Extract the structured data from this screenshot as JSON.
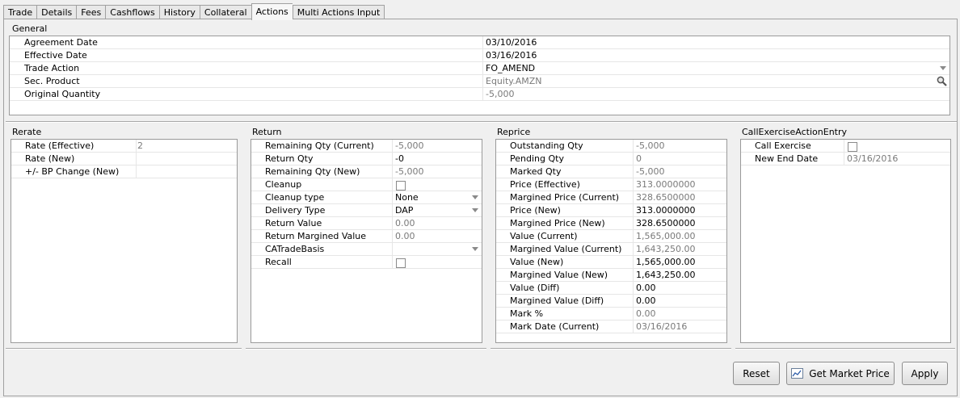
{
  "tabs": [
    {
      "label": "Trade",
      "active": false
    },
    {
      "label": "Details",
      "active": false
    },
    {
      "label": "Fees",
      "active": false
    },
    {
      "label": "Cashflows",
      "active": false
    },
    {
      "label": "History",
      "active": false
    },
    {
      "label": "Collateral",
      "active": false
    },
    {
      "label": "Actions",
      "active": true
    },
    {
      "label": "Multi Actions Input",
      "active": false
    }
  ],
  "general": {
    "title": "General",
    "rows": [
      {
        "label": "Agreement Date",
        "value": "03/10/2016"
      },
      {
        "label": "Effective Date",
        "value": "03/16/2016"
      },
      {
        "label": "Trade Action",
        "value": "FO_AMEND"
      },
      {
        "label": "Sec. Product",
        "value": "Equity.AMZN"
      },
      {
        "label": "Original Quantity",
        "value": "-5,000"
      }
    ]
  },
  "rerate": {
    "title": "Rerate",
    "rows": [
      {
        "label": "Rate (Effective)",
        "value": "2"
      },
      {
        "label": "Rate (New)",
        "value": ""
      },
      {
        "label": "+/- BP Change (New)",
        "value": ""
      }
    ]
  },
  "return": {
    "title": "Return",
    "rows": [
      {
        "label": "Remaining Qty (Current)",
        "value": "-5,000"
      },
      {
        "label": "Return Qty",
        "value": "-0"
      },
      {
        "label": "Remaining Qty (New)",
        "value": "-5,000"
      },
      {
        "label": "Cleanup",
        "value": ""
      },
      {
        "label": "Cleanup type",
        "value": "None"
      },
      {
        "label": "Delivery Type",
        "value": "DAP"
      },
      {
        "label": "Return Value",
        "value": "0.00"
      },
      {
        "label": "Return Margined Value",
        "value": "0.00"
      },
      {
        "label": "CATradeBasis",
        "value": ""
      },
      {
        "label": "Recall",
        "value": ""
      }
    ]
  },
  "reprice": {
    "title": "Reprice",
    "rows": [
      {
        "label": "Outstanding Qty",
        "value": "-5,000"
      },
      {
        "label": "Pending Qty",
        "value": "0"
      },
      {
        "label": "Marked Qty",
        "value": "-5,000"
      },
      {
        "label": "Price (Effective)",
        "value": "313.0000000"
      },
      {
        "label": "Margined Price (Current)",
        "value": "328.6500000"
      },
      {
        "label": "Price (New)",
        "value": "313.0000000"
      },
      {
        "label": "Margined Price (New)",
        "value": "328.6500000"
      },
      {
        "label": "Value (Current)",
        "value": "1,565,000.00"
      },
      {
        "label": "Margined Value (Current)",
        "value": "1,643,250.00"
      },
      {
        "label": "Value (New)",
        "value": "1,565,000.00"
      },
      {
        "label": "Margined Value (New)",
        "value": "1,643,250.00"
      },
      {
        "label": "Value (Diff)",
        "value": "0.00"
      },
      {
        "label": "Margined Value (Diff)",
        "value": "0.00"
      },
      {
        "label": "Mark %",
        "value": "0.00"
      },
      {
        "label": "Mark Date (Current)",
        "value": "03/16/2016"
      }
    ]
  },
  "callexercise": {
    "title": "CallExerciseActionEntry",
    "rows": [
      {
        "label": "Call Exercise",
        "value": ""
      },
      {
        "label": "New End Date",
        "value": "03/16/2016"
      }
    ]
  },
  "buttons": {
    "reset": "Reset",
    "get_market_price": "Get Market Price",
    "apply": "Apply"
  },
  "icons": {
    "search": "magnifier-icon",
    "chart": "line-chart-icon",
    "dropdown": "chevron-down-icon"
  }
}
